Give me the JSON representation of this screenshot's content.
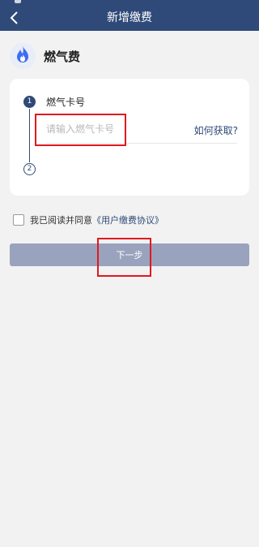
{
  "header": {
    "title": "新增缴费"
  },
  "service": {
    "title": "燃气费",
    "icon": "flame-icon",
    "icon_color": "#3f6df2"
  },
  "form": {
    "step1_number": "1",
    "step2_number": "2",
    "card_label": "燃气卡号",
    "card_placeholder": "请输入燃气卡号",
    "card_value": "",
    "help_link": "如何获取?"
  },
  "agreement": {
    "text": "我已阅读并同意",
    "link": "《用户缴费协议》",
    "checked": false
  },
  "next_button": {
    "label": "下一步"
  },
  "colors": {
    "primary": "#2f4a78",
    "button_disabled": "#9aa3bd",
    "highlight": "#e0191f",
    "background": "#f2f2f2"
  }
}
